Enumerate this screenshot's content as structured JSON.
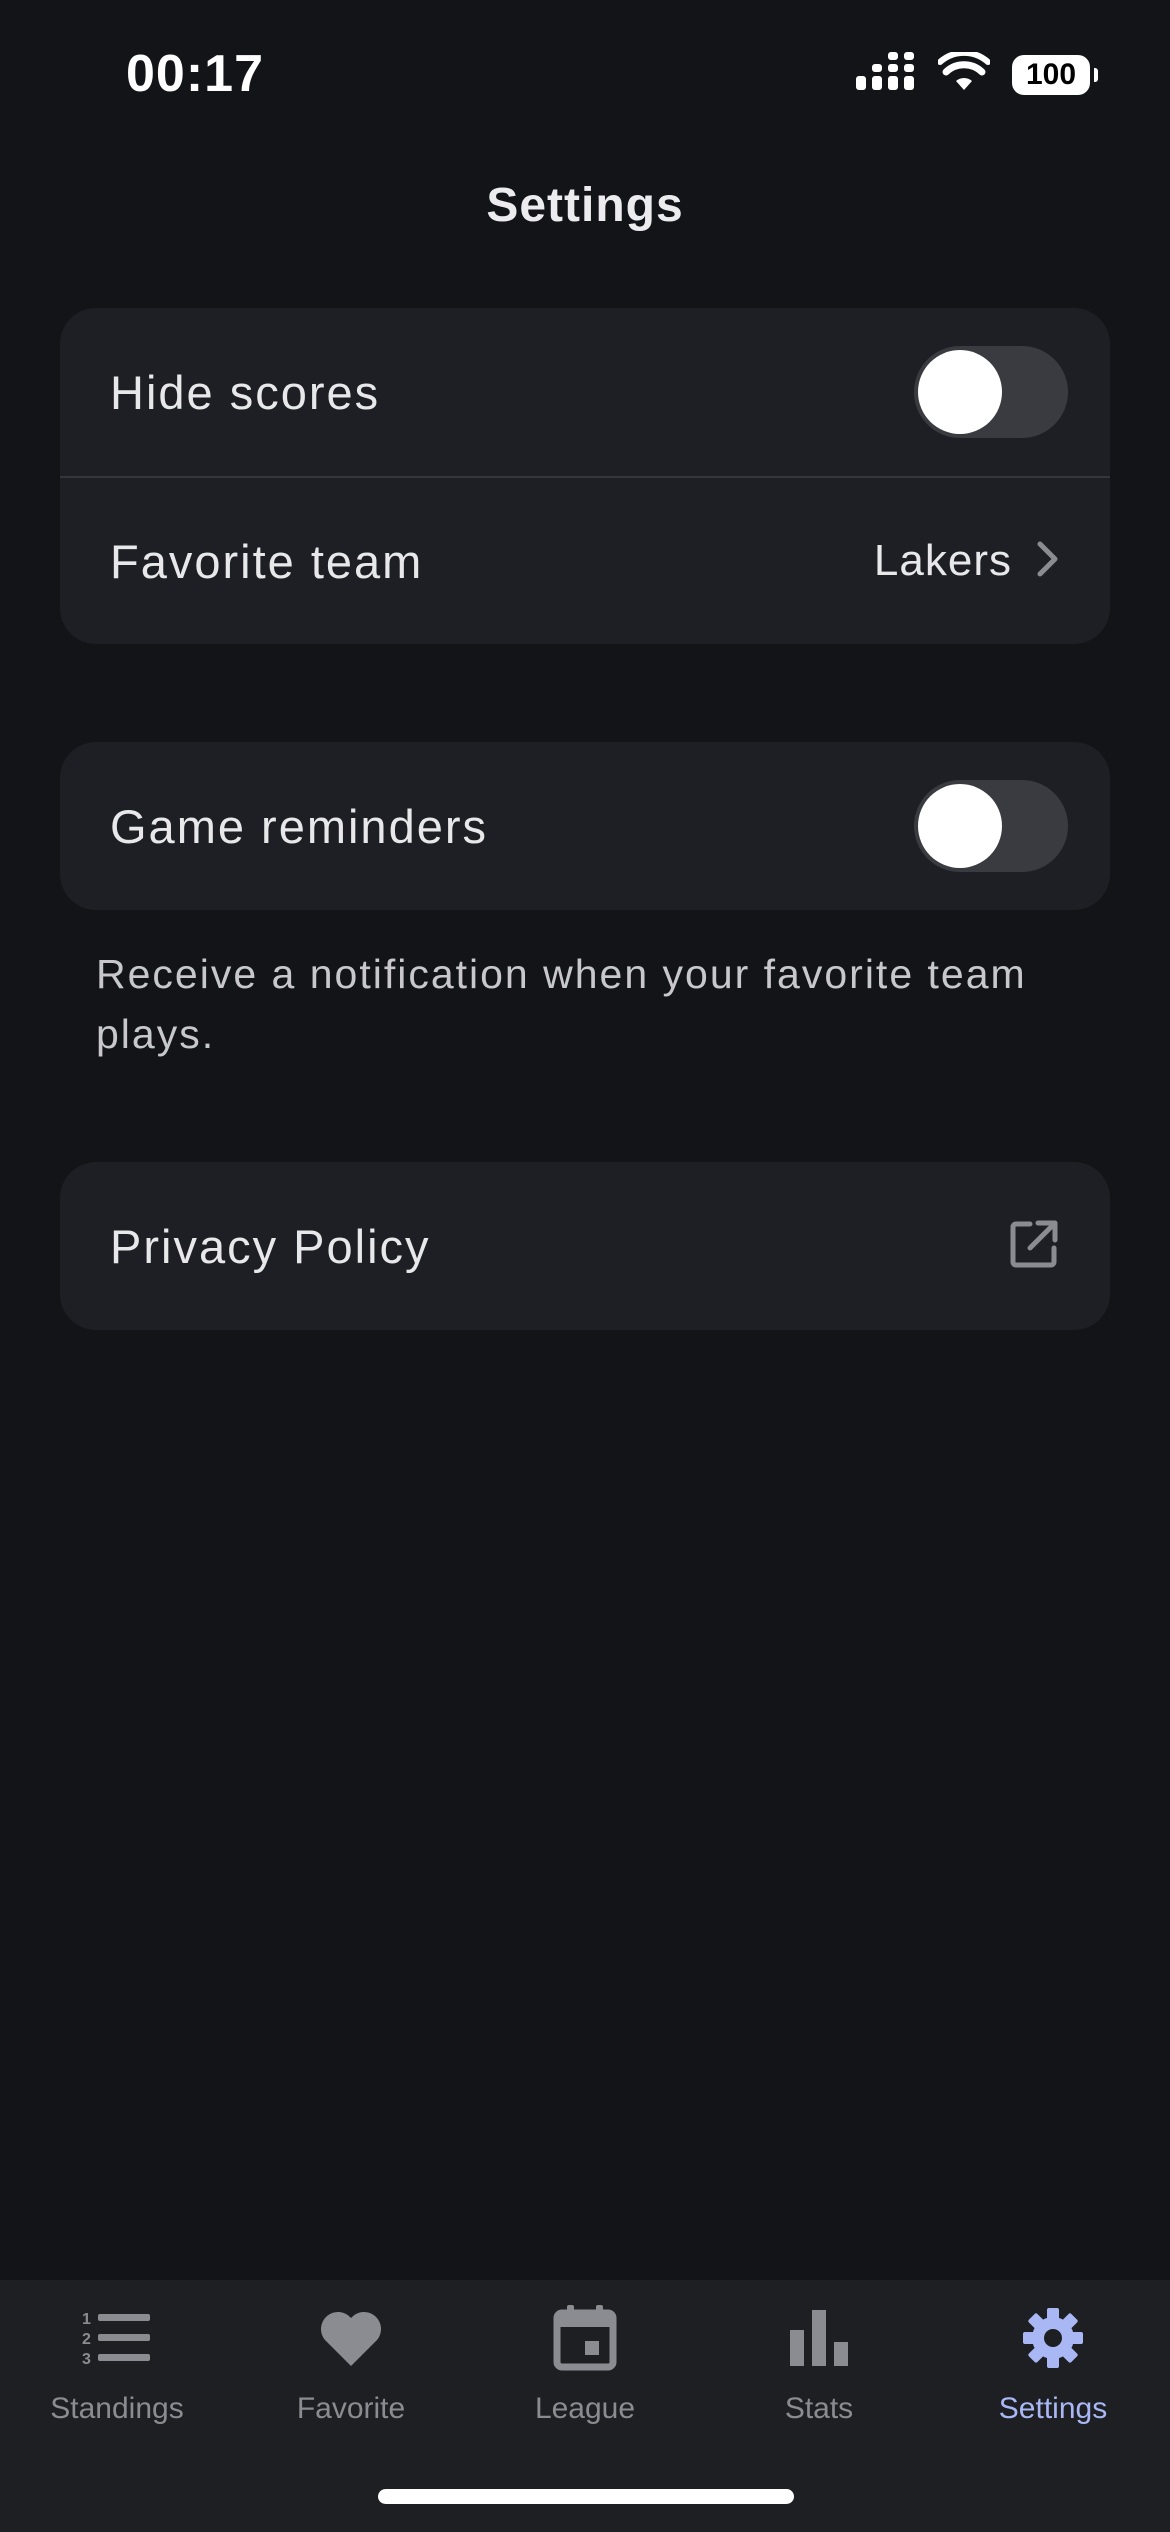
{
  "status_bar": {
    "time": "00:17",
    "battery": "100",
    "icons": [
      "cellular-signal-icon",
      "wifi-icon",
      "battery-icon"
    ]
  },
  "header": {
    "title": "Settings"
  },
  "settings": {
    "hide_scores": {
      "label": "Hide scores",
      "enabled": false
    },
    "favorite_team": {
      "label": "Favorite team",
      "value": "Lakers",
      "icon": "chevron-right-icon"
    },
    "game_reminders": {
      "label": "Game reminders",
      "enabled": false,
      "helper": "Receive a notification when your favorite team plays."
    },
    "privacy_policy": {
      "label": "Privacy Policy",
      "icon": "external-link-icon"
    }
  },
  "tab_bar": {
    "tabs": [
      {
        "label": "Standings",
        "icon": "standings-list-icon",
        "active": false
      },
      {
        "label": "Favorite",
        "icon": "heart-icon",
        "active": false
      },
      {
        "label": "League",
        "icon": "calendar-icon",
        "active": false
      },
      {
        "label": "Stats",
        "icon": "bar-chart-icon",
        "active": false
      },
      {
        "label": "Settings",
        "icon": "gear-icon",
        "active": true
      }
    ]
  },
  "colors": {
    "background": "#131418",
    "card": "#1d1f24",
    "tab_active": "#a9b8f5",
    "tab_inactive": "#8b8c91",
    "toggle_off_track": "#3a3b41"
  }
}
